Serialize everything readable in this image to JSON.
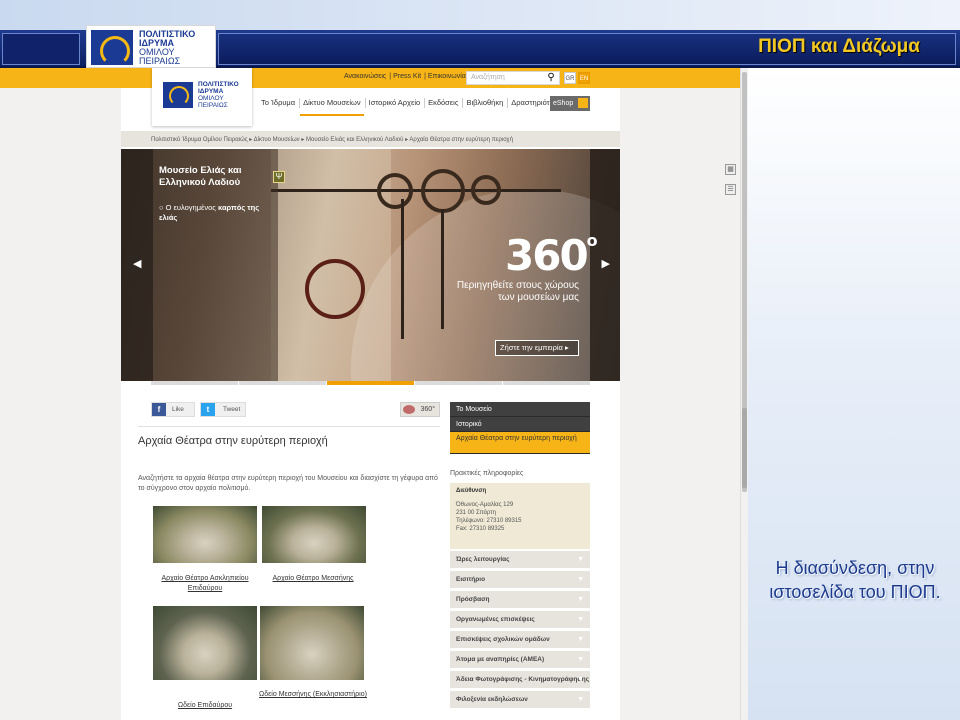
{
  "slide": {
    "title": "ΠΙΟΠ και Διάζωμα",
    "logo_lines": [
      "ΠΟΛΙΤΙΣΤΙΚΟ",
      "ΙΔΡΥΜΑ",
      "ΟΜΙΛΟΥ",
      "ΠΕΙΡΑΙΩΣ"
    ],
    "caption": "Η διασύνδεση, στην ιστοσελίδα του ΠΙΟΠ."
  },
  "site": {
    "logo_lines": [
      "ΠΟΛΙΤΙΣΤΙΚΟ",
      "ΙΔΡΥΜΑ",
      "ΟΜΙΛΟΥ",
      "ΠΕΙΡΑΙΩΣ"
    ],
    "toplinks": [
      "Ανακοινώσεις",
      "Press Kit",
      "Επικοινωνία"
    ],
    "search_placeholder": "Αναζήτηση",
    "languages": [
      "GR",
      "EN"
    ],
    "nav": [
      "Το Ίδρυμα",
      "Δίκτυο Μουσείων",
      "Ιστορικό Αρχείο",
      "Εκδόσεις",
      "Βιβλιοθήκη",
      "Δραστηριότητες"
    ],
    "nav_active_index": 1,
    "eshop": "eShop",
    "breadcrumb": "Πολιτιστικό Ίδρυμα Ομίλου Πειραιώς  ▸  Δίκτυο Μουσείων  ▸  Μουσείο Ελιάς και Ελληνικού Λαδιού  ▸  Αρχαία Θέατρα στην ευρύτερη περιοχή",
    "hero": {
      "title": "Μουσείο Ελιάς και Ελληνικού Λαδιού",
      "sub_prefix": "Ο ευλογημένος",
      "sub_bold": "καρπός της ελιάς",
      "big": "360",
      "big_sup": "o",
      "line": "Περιηγηθείτε στους χώρους των μουσείων μας",
      "cta": "Ζήστε την εμπειρία ▸"
    },
    "social": {
      "like": "Like",
      "tweet": "Tweet",
      "view360": "360°"
    },
    "heading": "Αρχαία Θέατρα στην ευρύτερη περιοχή",
    "intro": "Αναζητήστε τα αρχαία θέατρα στην ευρύτερη περιοχή του Μουσείου και διασχίστε τη γέφυρα από το σύγχρονο στον αρχαίο πολιτισμό.",
    "theatres": [
      {
        "caption": "Αρχαίο Θέατρο Ασκληπιείου Επιδαύρου",
        "tone": "#8b8a63"
      },
      {
        "caption": "Αρχαίο Θέατρο Μεσσήνης",
        "tone": "#6d7150"
      },
      {
        "caption": "Ωδείο Επιδαύρου",
        "tone": "#5e6350"
      },
      {
        "caption": "Ωδείο Μεσσήνης (Εκκλησιαστήριο)",
        "tone": "#9a9272"
      }
    ],
    "side_menu": [
      "Το Μουσείο",
      "Ιστορικό",
      "Αρχαία Θέατρα στην ευρύτερη περιοχή"
    ],
    "practical_title": "Πρακτικές πληροφορίες",
    "address": {
      "heading": "Διεύθυνση",
      "lines": [
        "Όθωνος-Αμαλίας 129",
        "231 00 Σπάρτη",
        "Τηλέφωνο: 27310 89315",
        "Fax: 27310 89325"
      ]
    },
    "accordion": [
      "Ώρες λειτουργίας",
      "Εισιτήριο",
      "Πρόσβαση",
      "Οργανωμένες επισκέψεις",
      "Επισκέψεις σχολικών ομάδων",
      "Άτομα με αναπηρίες (ΑΜΕΑ)",
      "Άδεια Φωτογράφισης - Κινηματογράφησης",
      "Φιλοξενία εκδηλώσεων"
    ],
    "colors": {
      "accent": "#f7b417",
      "dark_menu": "#404040",
      "brand_blue": "#1b3a93"
    }
  }
}
